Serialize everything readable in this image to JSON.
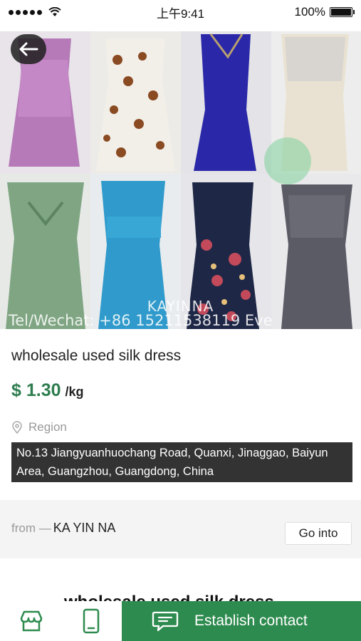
{
  "status_bar": {
    "time": "上午9:41",
    "battery": "100%"
  },
  "hero": {
    "watermark_brand": "KAYINNA",
    "watermark_contact": "Tel/Wechat: +86 15211538119 Eve"
  },
  "product": {
    "title": "wholesale used silk dress",
    "price": "$ 1.30",
    "unit": "/kg",
    "region_label": "Region",
    "address": "No.13 Jiangyuanhuochang Road, Quanxi, Jinaggao, Baiyun Area, Guangzhou, Guangdong, China"
  },
  "seller": {
    "from_label": "from —",
    "name": "KA YIN NA",
    "go_into": "Go into"
  },
  "next_section_title": "wholesale used silk dress",
  "bottom_bar": {
    "contact_label": "Establish contact"
  },
  "colors": {
    "accent_green": "#2e8b4f",
    "price_green": "#2e7d4f",
    "address_bg": "#333333"
  },
  "icons": [
    "back-arrow-icon",
    "location-pin-icon",
    "shop-icon",
    "phone-icon",
    "chat-icon"
  ]
}
